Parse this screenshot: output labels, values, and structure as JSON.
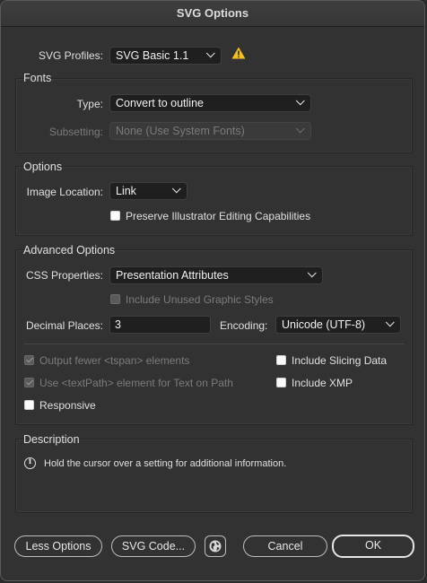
{
  "title": "SVG Options",
  "profiles": {
    "label": "SVG Profiles:",
    "value": "SVG Basic 1.1",
    "warning_icon": "warning-icon"
  },
  "fonts": {
    "title": "Fonts",
    "type_label": "Type:",
    "type_value": "Convert to outline",
    "subsetting_label": "Subsetting:",
    "subsetting_value": "None (Use System Fonts)"
  },
  "options": {
    "title": "Options",
    "image_location_label": "Image Location:",
    "image_location_value": "Link",
    "preserve_label": "Preserve Illustrator Editing Capabilities"
  },
  "advanced": {
    "title": "Advanced Options",
    "css_label": "CSS Properties:",
    "css_value": "Presentation Attributes",
    "unused_styles_label": "Include Unused Graphic Styles",
    "decimal_label": "Decimal Places:",
    "decimal_value": "3",
    "encoding_label": "Encoding:",
    "encoding_value": "Unicode (UTF-8)",
    "fewer_tspan_label": "Output fewer <tspan> elements",
    "textpath_label": "Use <textPath> element for Text on Path",
    "responsive_label": "Responsive",
    "slicing_label": "Include Slicing Data",
    "xmp_label": "Include XMP"
  },
  "description": {
    "title": "Description",
    "text": "Hold the cursor over a setting for additional information.",
    "info_icon": "info-icon"
  },
  "buttons": {
    "less_options": "Less Options",
    "svg_code": "SVG Code...",
    "globe_icon": "globe-icon",
    "cancel": "Cancel",
    "ok": "OK"
  }
}
